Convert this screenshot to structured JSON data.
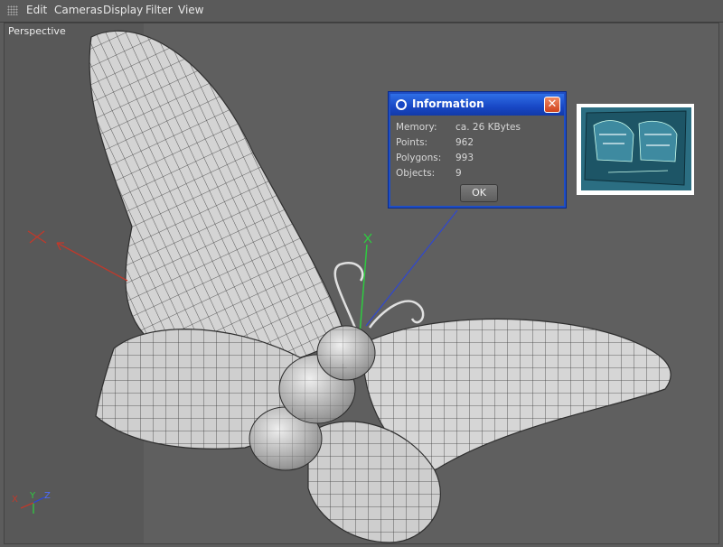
{
  "menubar": {
    "items": [
      {
        "label": "Edit"
      },
      {
        "label": "Cameras"
      },
      {
        "label": "Display"
      },
      {
        "label": "Filter"
      },
      {
        "label": "View"
      }
    ]
  },
  "viewport": {
    "label": "Perspective",
    "axis_labels": {
      "x": "X",
      "y": "Y",
      "z": "Z"
    }
  },
  "info_dialog": {
    "title": "Information",
    "rows": [
      {
        "key": "Memory:",
        "value": "ca. 26 KBytes"
      },
      {
        "key": "Points:",
        "value": "962"
      },
      {
        "key": "Polygons:",
        "value": "993"
      },
      {
        "key": "Objects:",
        "value": "9"
      }
    ],
    "ok_label": "OK",
    "close_glyph": "✕"
  },
  "colors": {
    "title_blue": "#1847c5",
    "axis_x": "#c0392b",
    "axis_y": "#2ecc40",
    "axis_z": "#2f47d0"
  }
}
